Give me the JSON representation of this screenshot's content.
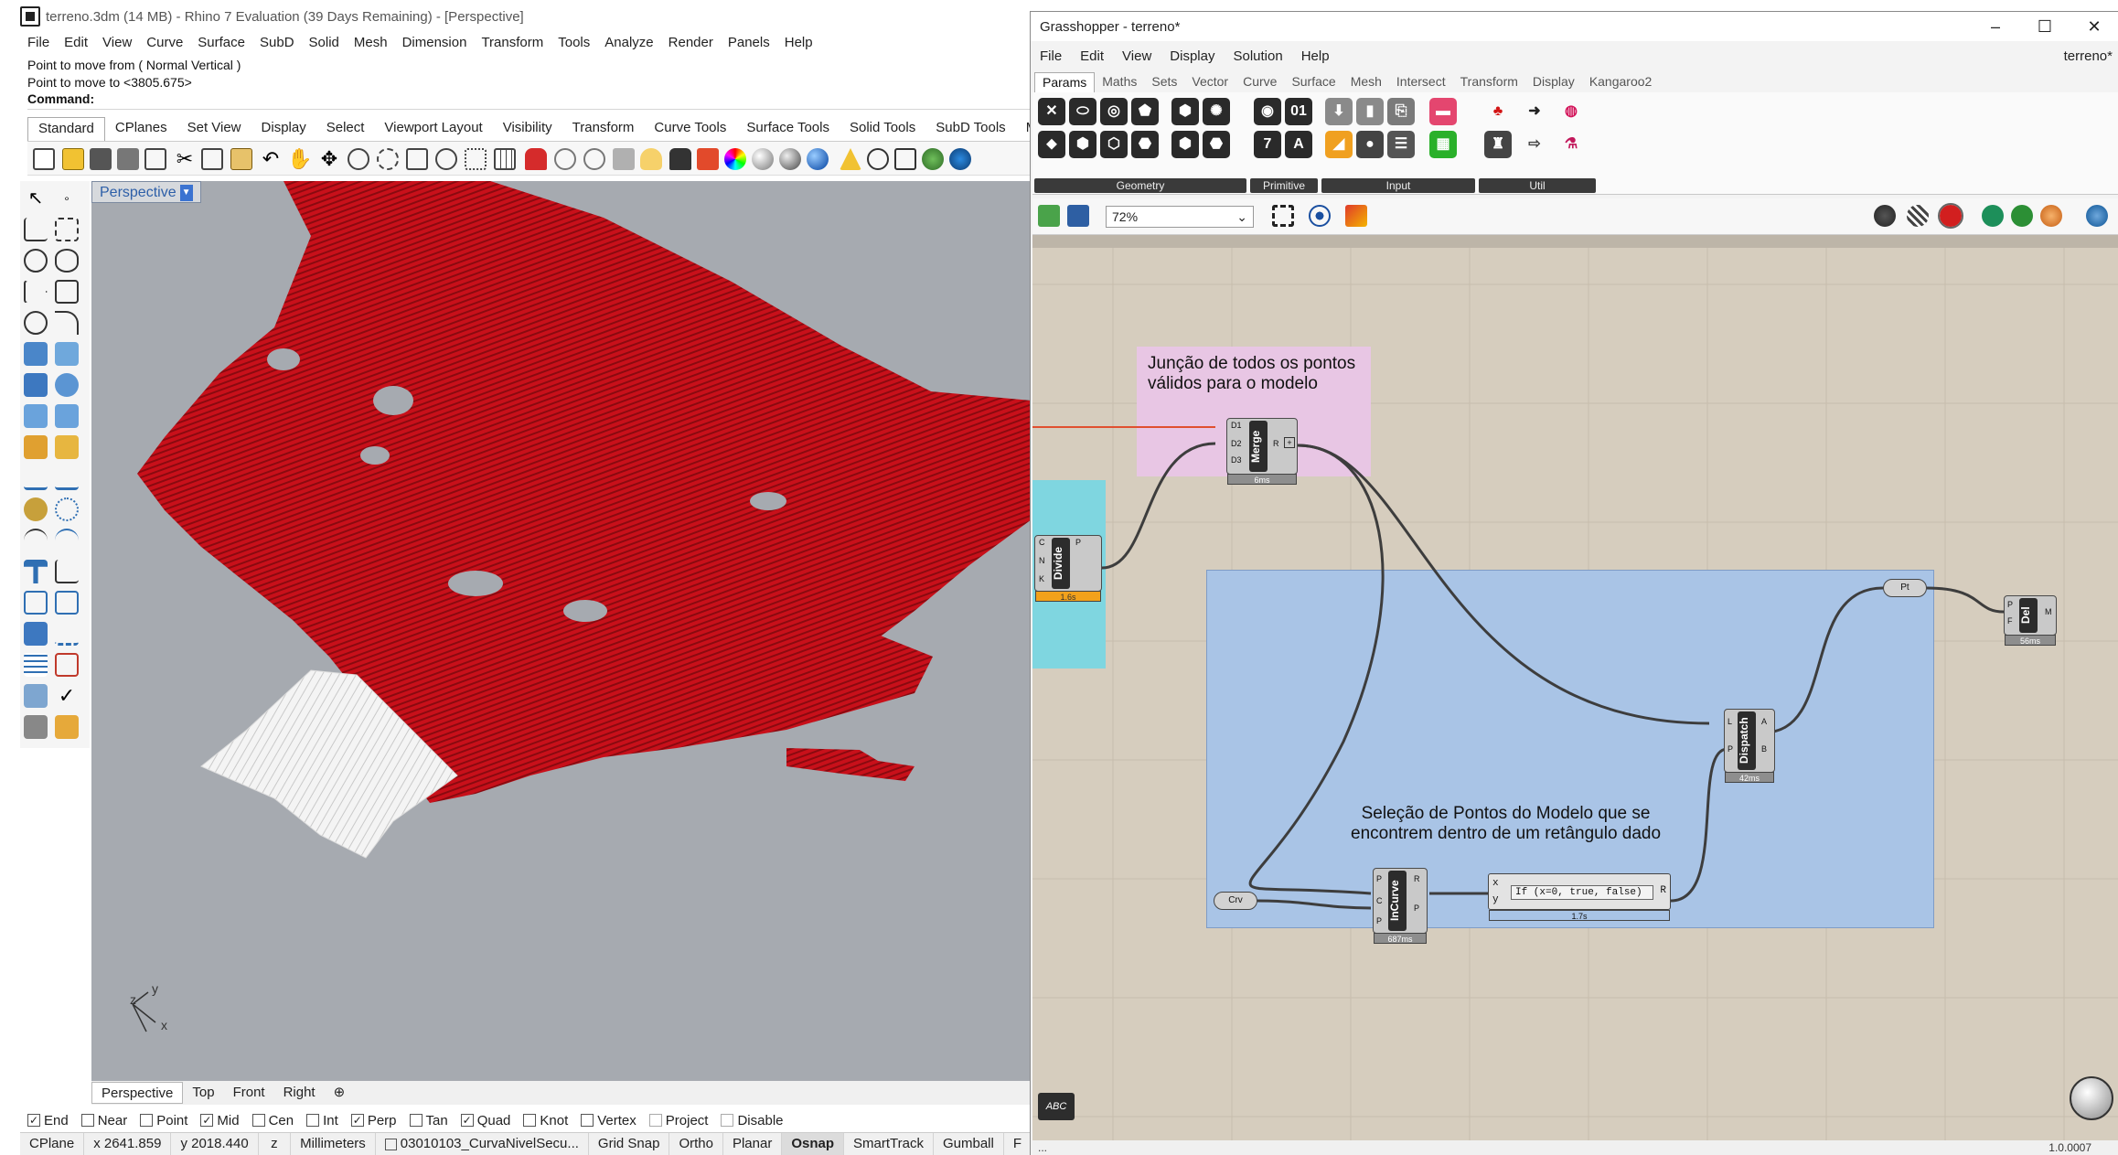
{
  "rhino": {
    "title": "terreno.3dm (14 MB) - Rhino 7 Evaluation (39 Days Remaining) - [Perspective]",
    "menu": [
      "File",
      "Edit",
      "View",
      "Curve",
      "Surface",
      "SubD",
      "Solid",
      "Mesh",
      "Dimension",
      "Transform",
      "Tools",
      "Analyze",
      "Render",
      "Panels",
      "Help"
    ],
    "command_history": [
      "Point to move from ( Normal  Vertical )",
      "Point to move to <3805.675>"
    ],
    "command_prompt": "Command:",
    "toolbar_tabs": [
      "Standard",
      "CPlanes",
      "Set View",
      "Display",
      "Select",
      "Viewport Layout",
      "Visibility",
      "Transform",
      "Curve Tools",
      "Surface Tools",
      "Solid Tools",
      "SubD Tools",
      "Me"
    ],
    "viewport_label": "Perspective",
    "viewport_axes": {
      "y": "y",
      "z": "z",
      "x": "x"
    },
    "viewport_tabs": [
      "Perspective",
      "Top",
      "Front",
      "Right"
    ],
    "osnaps": [
      {
        "label": "End",
        "checked": true
      },
      {
        "label": "Near",
        "checked": false
      },
      {
        "label": "Point",
        "checked": false
      },
      {
        "label": "Mid",
        "checked": true
      },
      {
        "label": "Cen",
        "checked": false
      },
      {
        "label": "Int",
        "checked": false
      },
      {
        "label": "Perp",
        "checked": true
      },
      {
        "label": "Tan",
        "checked": false
      },
      {
        "label": "Quad",
        "checked": true
      },
      {
        "label": "Knot",
        "checked": false
      },
      {
        "label": "Vertex",
        "checked": false
      },
      {
        "label": "Project",
        "checked": false
      },
      {
        "label": "Disable",
        "checked": false
      }
    ],
    "status": {
      "cplane": "CPlane",
      "x": "x 2641.859",
      "y": "y 2018.440",
      "z": "z",
      "units": "Millimeters",
      "layer": "03010103_CurvaNivelSecu...",
      "grid_snap": "Grid Snap",
      "ortho": "Ortho",
      "planar": "Planar",
      "osnap": "Osnap",
      "smarttrack": "SmartTrack",
      "gumball": "Gumball",
      "trailing": "F"
    }
  },
  "grasshopper": {
    "title": "Grasshopper - terreno*",
    "document": "terreno*",
    "menu": [
      "File",
      "Edit",
      "View",
      "Display",
      "Solution",
      "Help"
    ],
    "tabs": [
      "Params",
      "Maths",
      "Sets",
      "Vector",
      "Curve",
      "Surface",
      "Mesh",
      "Intersect",
      "Transform",
      "Display",
      "Kangaroo2"
    ],
    "ribbon_groups": [
      "Geometry",
      "Primitive",
      "Input",
      "Util"
    ],
    "zoom": "72%",
    "version": "1.0.0007",
    "footer_left": "...",
    "groups": {
      "merge_note": "Junção de todos os pontos\nválidos para o modelo",
      "selection_note": "Seleção de Pontos do Modelo que se\nencontrem dentro de um retângulo dado"
    },
    "components": {
      "merge": {
        "name": "Merge",
        "inputs": [
          "D1",
          "D2",
          "D3"
        ],
        "output": "R",
        "time": "6ms"
      },
      "divide": {
        "name": "Divide",
        "inputs": [
          "C",
          "N",
          "K"
        ],
        "output": "P",
        "time": "1.6s"
      },
      "dispatch": {
        "name": "Dispatch",
        "inputs": [
          "L",
          "P"
        ],
        "outputs": [
          "A",
          "B"
        ],
        "time": "42ms"
      },
      "incurve": {
        "name": "InCurve",
        "inputs": [
          "P",
          "C",
          "P"
        ],
        "outputs": [
          "R",
          "P"
        ],
        "time": "687ms"
      },
      "expression": {
        "text": "If (x=0, true, false)",
        "inputs": [
          "x",
          "y"
        ],
        "output": "R",
        "time": "1.7s"
      },
      "del": {
        "name": "Del",
        "inputs": [
          "P",
          "F"
        ],
        "output": "M",
        "time": "56ms"
      },
      "pt_param": "Pt",
      "crv_param": "Crv"
    },
    "colors": {
      "merge_group": "#e8c6e4",
      "selection_group": "#a9c4e6",
      "divide_group": "#7fd6e0",
      "canvas": "#d6cdbe",
      "wire": "#3d3d3d",
      "red_wire": "#e05030"
    }
  }
}
